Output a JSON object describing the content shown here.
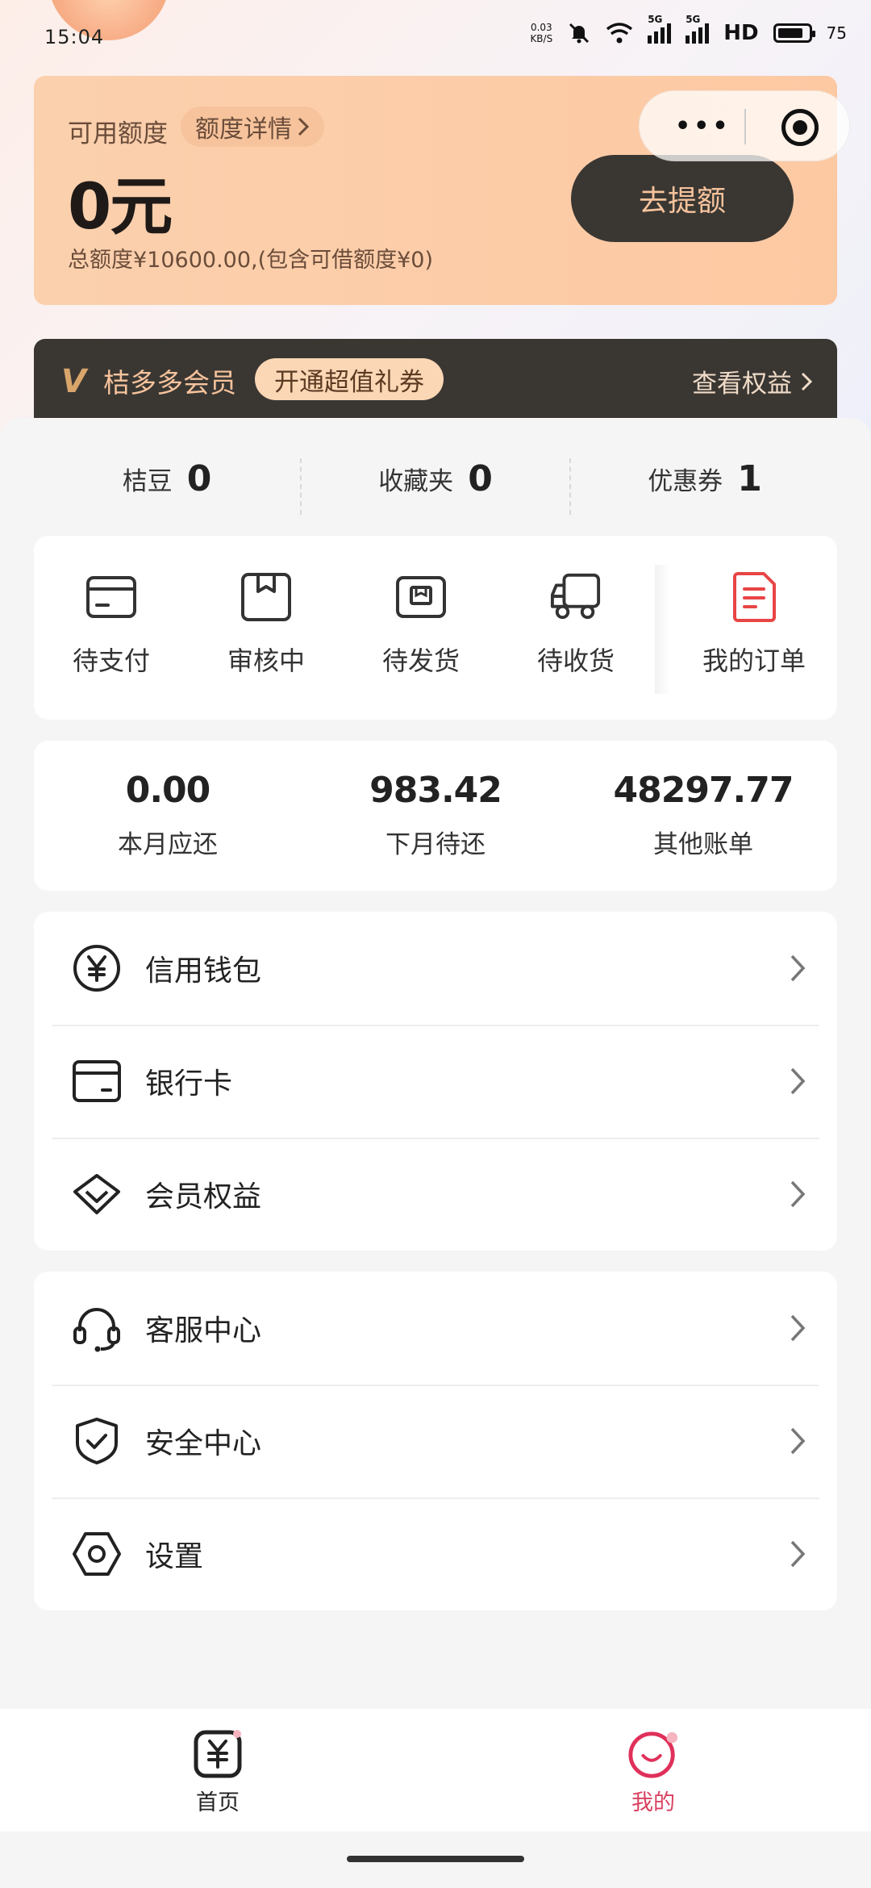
{
  "status_bar": {
    "time": "15:04",
    "net_speed_value": "0.03",
    "net_speed_unit": "KB/S",
    "signal1_label": "5G",
    "signal2_label": "5G",
    "hd_label": "HD",
    "battery": "75",
    "icons": [
      "mute-bell-icon",
      "wifi-icon",
      "signal-icon",
      "signal-icon",
      "battery-icon"
    ]
  },
  "credit": {
    "available_label": "可用额度",
    "detail_label": "额度详情",
    "amount": "0元",
    "total_text": "总额度¥10600.00,(包含可借额度¥0)",
    "raise_button": "去提额"
  },
  "capsule": {
    "more_label": "•••"
  },
  "member": {
    "title": "桔多多会员",
    "coupon": "开通超值礼券",
    "benefits": "查看权益"
  },
  "stats": [
    {
      "label": "桔豆",
      "value": "0"
    },
    {
      "label": "收藏夹",
      "value": "0"
    },
    {
      "label": "优惠券",
      "value": "1"
    }
  ],
  "orders": [
    {
      "label": "待支付",
      "icon": "card-icon"
    },
    {
      "label": "审核中",
      "icon": "box-icon"
    },
    {
      "label": "待发货",
      "icon": "package-icon"
    },
    {
      "label": "待收货",
      "icon": "truck-icon"
    },
    {
      "label": "我的订单",
      "icon": "order-list-icon"
    }
  ],
  "bills": [
    {
      "value": "0.00",
      "label": "本月应还"
    },
    {
      "value": "983.42",
      "label": "下月待还"
    },
    {
      "value": "48297.77",
      "label": "其他账单"
    }
  ],
  "menu1": [
    {
      "label": "信用钱包",
      "icon": "yuan-circle-icon"
    },
    {
      "label": "银行卡",
      "icon": "bank-card-icon"
    },
    {
      "label": "会员权益",
      "icon": "diamond-icon"
    }
  ],
  "menu2": [
    {
      "label": "客服中心",
      "icon": "headset-icon"
    },
    {
      "label": "安全中心",
      "icon": "shield-check-icon"
    },
    {
      "label": "设置",
      "icon": "hexagon-settings-icon"
    }
  ],
  "nav": [
    {
      "label": "首页",
      "icon": "home-yuan-icon",
      "active": false
    },
    {
      "label": "我的",
      "icon": "smile-icon",
      "active": true
    }
  ],
  "colors": {
    "accent_orange": "#fdc9a3",
    "dark_button": "#3a3733",
    "active_tab": "#d94060"
  }
}
